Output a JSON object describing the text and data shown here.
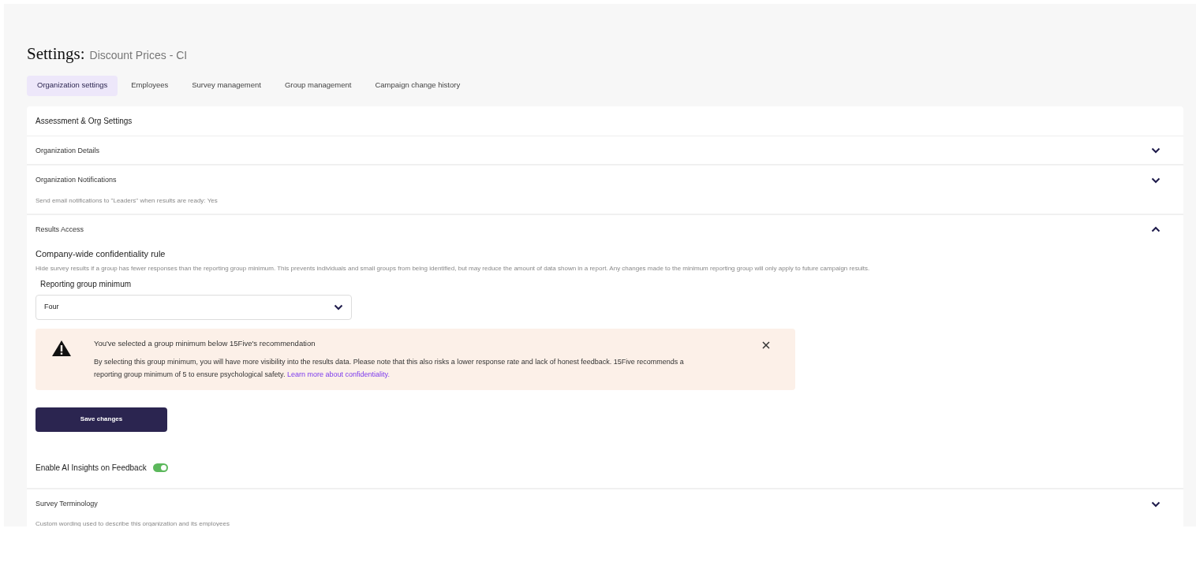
{
  "page": {
    "title": "Settings:",
    "subtitle": "Discount Prices - CI"
  },
  "tabs": [
    {
      "label": "Organization settings",
      "selected": true
    },
    {
      "label": "Employees",
      "selected": false
    },
    {
      "label": "Survey management",
      "selected": false
    },
    {
      "label": "Group management",
      "selected": false
    },
    {
      "label": "Campaign change history",
      "selected": false
    }
  ],
  "card": {
    "title": "Assessment & Org Settings",
    "sections": [
      {
        "title": "Organization Details",
        "expanded": false
      },
      {
        "title": "Organization Notifications",
        "description": "Send email notifications to \"Leaders\" when results are ready: Yes",
        "expanded": false
      },
      {
        "title": "Results Access",
        "expanded": true,
        "content": {
          "rule_title": "Company-wide confidentiality rule",
          "rule_description": "Hide survey results if a group has fewer responses than the reporting group minimum. This prevents individuals and small groups from being identified, but may reduce the amount of data shown in a report. Any changes made to the minimum reporting group will only apply to future campaign results.",
          "select": {
            "label": "Reporting group minimum",
            "value": "Four"
          },
          "alert": {
            "title": "You've selected a group minimum below 15Five's recommendation",
            "body": "By selecting this group minimum, you will have more visibility into the results data. Please note that this also risks a lower response rate and lack of honest feedback. 15Five recommends a reporting group minimum of 5 to ensure psychological safety.",
            "link": "Learn more about confidentiality."
          },
          "save_button": "Save changes",
          "toggle": {
            "label": "Enable AI Insights on Feedback",
            "on": true
          }
        }
      },
      {
        "title": "Survey Terminology",
        "description": "Custom wording used to describe this organization and its employees",
        "expanded": false
      }
    ]
  }
}
